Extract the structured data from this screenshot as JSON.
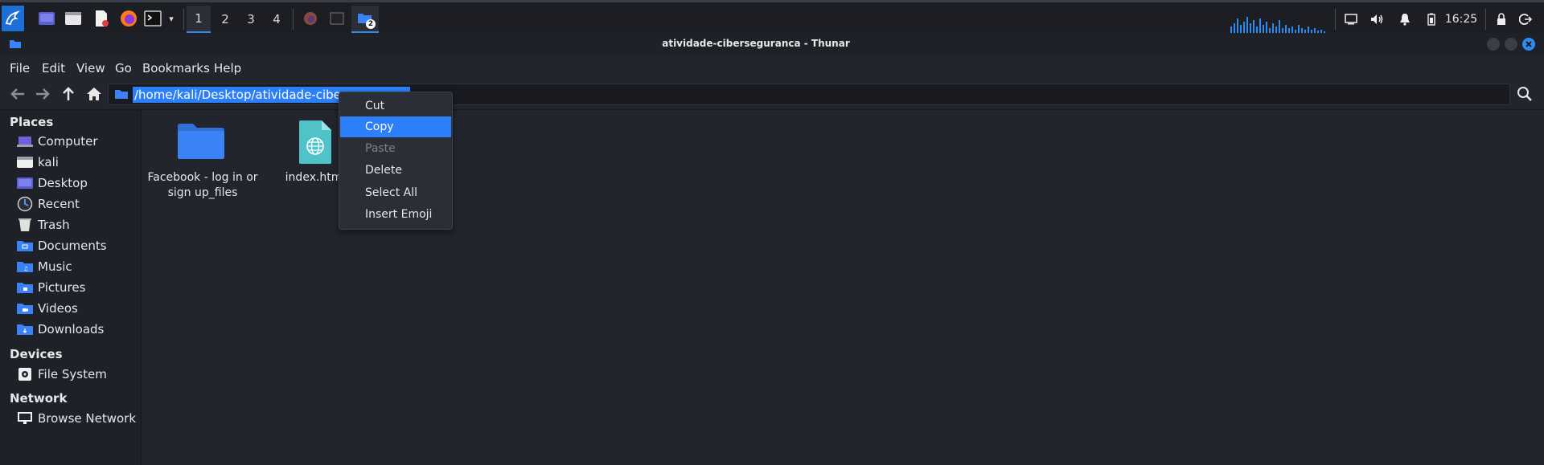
{
  "taskbar": {
    "workspaces": [
      "1",
      "2",
      "3",
      "4"
    ],
    "active_workspace": "1",
    "clock": "16:25",
    "file_manager_badge": "2"
  },
  "window": {
    "title": "atividade-ciberseguranca - Thunar"
  },
  "menubar": {
    "file": "File",
    "edit": "Edit",
    "view": "View",
    "go": "Go",
    "bookmarks": "Bookmarks",
    "help": "Help"
  },
  "location": {
    "path": "/home/kali/Desktop/atividade-ciberseguranca"
  },
  "sidebar": {
    "places_header": "Places",
    "places": [
      "Computer",
      "kali",
      "Desktop",
      "Recent",
      "Trash",
      "Documents",
      "Music",
      "Pictures",
      "Videos",
      "Downloads"
    ],
    "devices_header": "Devices",
    "devices": [
      "File System"
    ],
    "network_header": "Network",
    "network": [
      "Browse Network"
    ]
  },
  "files": [
    {
      "name_line1": "Facebook - log in or",
      "name_line2": "sign up_files",
      "icon": "folder-icon"
    },
    {
      "name_line1": "index.html",
      "name_line2": "",
      "icon": "html-file-icon"
    }
  ],
  "context_menu": {
    "items": [
      "Cut",
      "Copy",
      "Paste",
      "Delete",
      "Select All",
      "Insert Emoji"
    ],
    "highlighted": "Copy",
    "disabled": [
      "Paste"
    ]
  },
  "colors": {
    "accent": "#2d7ff9",
    "folder": "#3b82f6",
    "html_file": "#4fc3c8",
    "background": "#23252e"
  }
}
